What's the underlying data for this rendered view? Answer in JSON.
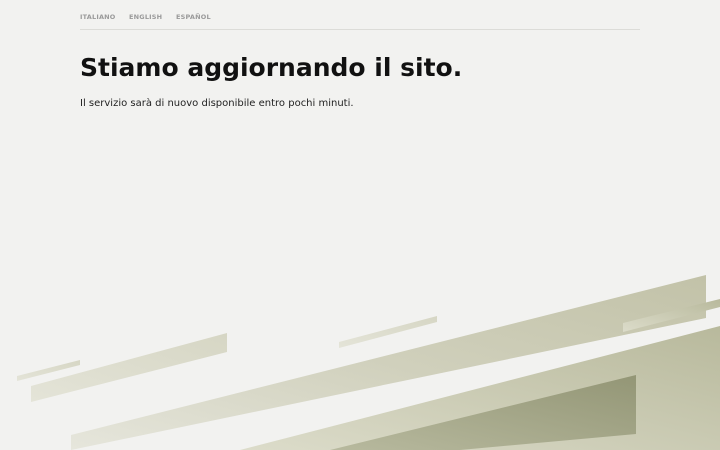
{
  "language_nav": {
    "items": [
      {
        "label": "ITALIANO"
      },
      {
        "label": "ENGLISH"
      },
      {
        "label": "ESPAÑOL"
      }
    ]
  },
  "main": {
    "title": "Stiamo aggiornando il sito.",
    "message": "Il servizio sarà di nuovo disponibile entro pochi minuti."
  },
  "colors": {
    "background": "#f2f2f0",
    "decor_light": "#dcdcc8",
    "decor_dark": "#9a9c78"
  }
}
